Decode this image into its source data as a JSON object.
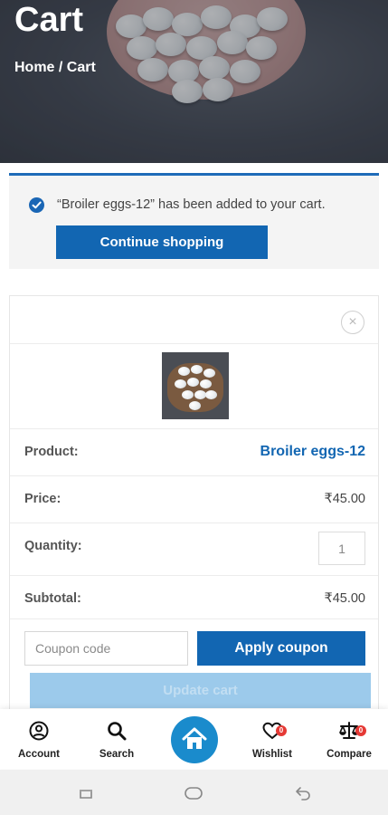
{
  "hero": {
    "title": "Cart",
    "breadcrumb": "Home / Cart"
  },
  "notice": {
    "message": "“Broiler eggs-12” has been added to your cart.",
    "button": "Continue shopping"
  },
  "cart_item": {
    "remove_label": "×",
    "product_label": "Product:",
    "product_name": "Broiler eggs-12",
    "price_label": "Price:",
    "price": "₹45.00",
    "quantity_label": "Quantity:",
    "quantity": "1",
    "subtotal_label": "Subtotal:",
    "subtotal": "₹45.00"
  },
  "coupon": {
    "placeholder": "Coupon code",
    "apply_label": "Apply coupon"
  },
  "update_label": "Update cart",
  "bottom_nav": {
    "account": "Account",
    "search": "Search",
    "wishlist": "Wishlist",
    "wishlist_count": "0",
    "compare": "Compare",
    "compare_count": "0"
  },
  "colors": {
    "primary": "#1266b2",
    "home": "#1a8bcc",
    "badge": "#e53935"
  }
}
